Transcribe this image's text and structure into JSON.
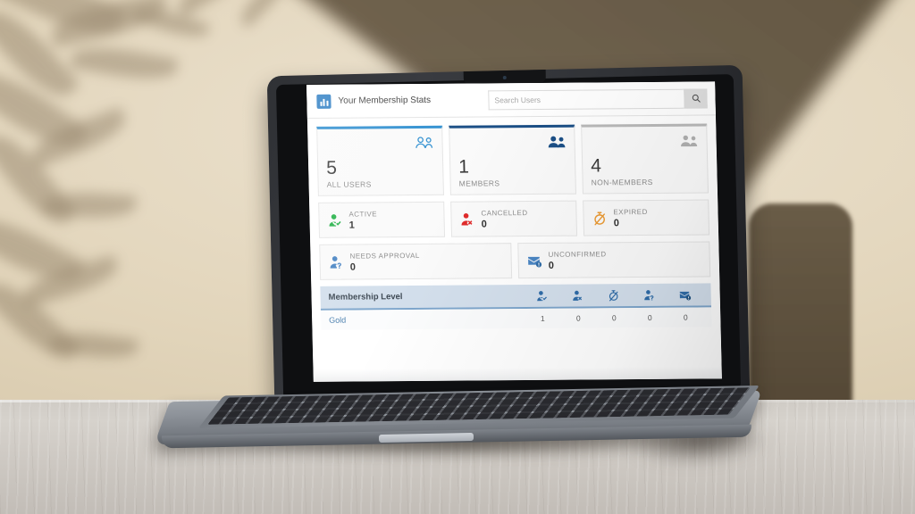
{
  "app": {
    "title": "Your Membership Stats",
    "logo_icon": "bar-chart-icon",
    "accent_blue": "#2f7fc4",
    "accent_dark_blue": "#1b4f86",
    "accent_light_blue": "#2f8fd0",
    "accent_grey": "#b9b9b9"
  },
  "search": {
    "placeholder": "Search Users",
    "value": "",
    "button_icon": "search-icon"
  },
  "summary_cards": [
    {
      "value": "5",
      "label": "ALL USERS",
      "icon": "users-outline-icon",
      "accent": "#2f8fd0",
      "icon_color": "#2f8fd0"
    },
    {
      "value": "1",
      "label": "MEMBERS",
      "icon": "users-filled-icon",
      "accent": "#1b4f86",
      "icon_color": "#1b4f86"
    },
    {
      "value": "4",
      "label": "NON-MEMBERS",
      "icon": "users-grey-icon",
      "accent": "#b9b9b9",
      "icon_color": "#b0b0b0"
    }
  ],
  "status_cards": [
    {
      "label": "ACTIVE",
      "value": "1",
      "icon": "user-check-icon",
      "color": "#27b24a"
    },
    {
      "label": "CANCELLED",
      "value": "0",
      "icon": "user-x-icon",
      "color": "#e02b2b"
    },
    {
      "label": "EXPIRED",
      "value": "0",
      "icon": "stopwatch-off-icon",
      "color": "#eb9a33"
    },
    {
      "label": "NEEDS APPROVAL",
      "value": "0",
      "icon": "user-question-icon",
      "color": "#4b86c4"
    },
    {
      "label": "UNCONFIRMED",
      "value": "0",
      "icon": "mail-alert-icon",
      "color": "#4b86c4"
    }
  ],
  "table": {
    "title": "Membership Level",
    "column_icons": [
      "user-check-icon",
      "user-x-icon",
      "stopwatch-off-icon",
      "user-question-icon",
      "mail-alert-icon"
    ],
    "rows": [
      {
        "level": "Gold",
        "values": [
          "1",
          "0",
          "0",
          "0",
          "0"
        ]
      }
    ]
  }
}
